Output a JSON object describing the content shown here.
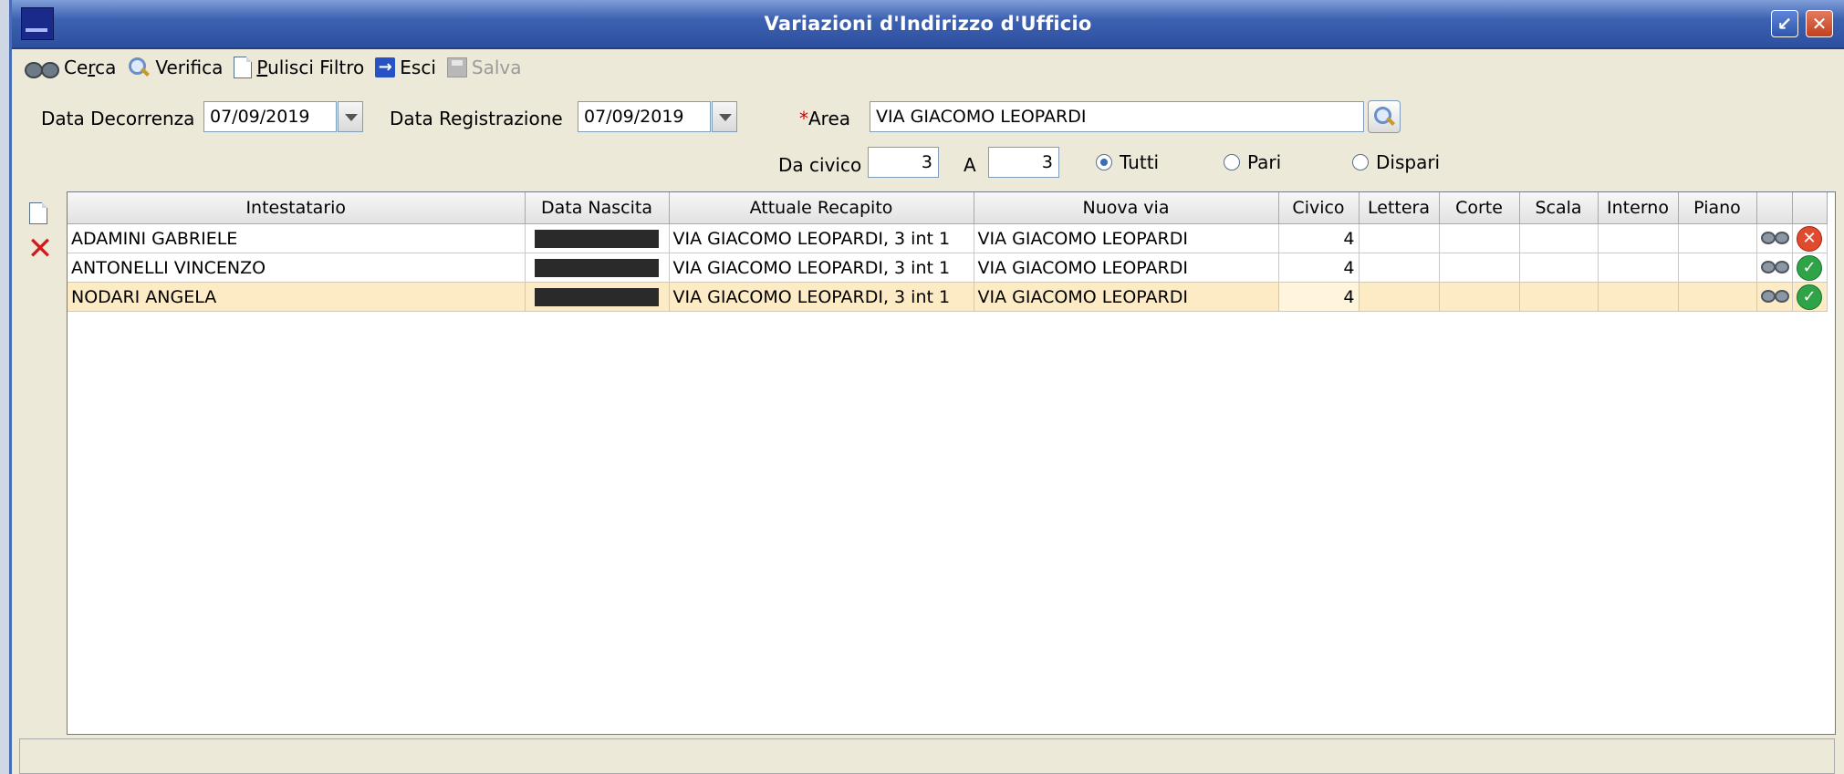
{
  "window": {
    "title": "Variazioni d'Indirizzo d'Ufficio",
    "logo_icon": "app-logo-icon",
    "restore_icon": "restore-icon",
    "close_icon": "close-icon"
  },
  "toolbar": {
    "cerca": "Cerca",
    "verifica": "Verifica",
    "pulisci": "Pulisci Filtro",
    "esci": "Esci",
    "salva": "Salva"
  },
  "filters": {
    "data_decorrenza_label": "Data Decorrenza",
    "data_decorrenza_value": "07/09/2019",
    "data_registrazione_label": "Data Registrazione",
    "data_registrazione_value": "07/09/2019",
    "required_marker": "*",
    "area_label": "Area",
    "area_value": "VIA GIACOMO LEOPARDI",
    "da_civico_label": "Da civico",
    "da_civico_value": "3",
    "a_label": "A",
    "a_value": "3",
    "radio_tutti": "Tutti",
    "radio_pari": "Pari",
    "radio_dispari": "Dispari",
    "selected_radio": "Tutti"
  },
  "grid": {
    "columns": [
      "Intestatario",
      "Data Nascita",
      "Attuale Recapito",
      "Nuova via",
      "Civico",
      "Lettera",
      "Corte",
      "Scala",
      "Interno",
      "Piano",
      "",
      ""
    ],
    "rows": [
      {
        "intestatario": "ADAMINI GABRIELE",
        "data_nascita": "[redacted]",
        "attuale_recapito": "VIA GIACOMO LEOPARDI, 3 int 1",
        "nuova_via": "VIA GIACOMO LEOPARDI",
        "civico": "4",
        "status": "error",
        "selected": false
      },
      {
        "intestatario": "ANTONELLI VINCENZO",
        "data_nascita": "[redacted]",
        "attuale_recapito": "VIA GIACOMO LEOPARDI, 3 int 1",
        "nuova_via": "VIA GIACOMO LEOPARDI",
        "civico": "4",
        "status": "ok",
        "selected": false
      },
      {
        "intestatario": "NODARI ANGELA",
        "data_nascita": "[redacted]",
        "attuale_recapito": "VIA GIACOMO LEOPARDI, 3 int 1",
        "nuova_via": "VIA GIACOMO LEOPARDI",
        "civico": "4",
        "status": "ok",
        "selected": true
      }
    ]
  },
  "colors": {
    "titlebar": "#2c4f9e",
    "selected_row": "#fcebc4",
    "status_ok": "#2fa347",
    "status_error": "#e04a2f",
    "required": "#d40000"
  }
}
